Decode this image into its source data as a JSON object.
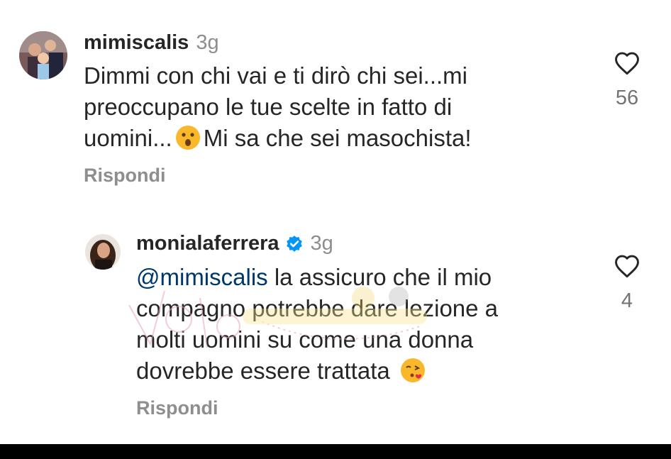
{
  "comments": [
    {
      "username": "mimiscalis",
      "time": "3g",
      "lines": [
        "Dimmi con chi vai e ti dirò  chi sei...mi",
        "preoccupano  le tue scelte in fatto di",
        "uomini...",
        "Mi sa che sei masochista!"
      ],
      "emoji": "hushed-face-emoji",
      "like_count": "56",
      "reply_label": "Rispondi"
    },
    {
      "username": "monialaferrera",
      "verified": true,
      "time": "3g",
      "mention": "@mimiscalis",
      "lines": [
        "la assicuro che il mio",
        "compagno potrebbe dare lezione a",
        "molti uomini su come una donna",
        "dovrebbe essere trattata"
      ],
      "emoji": "face-blowing-kiss-emoji",
      "like_count": "4",
      "reply_label": "Rispondi"
    }
  ],
  "colors": {
    "text": "#262626",
    "secondary": "#8e8e8e",
    "mention": "#00376b",
    "verified": "#0095f6"
  }
}
